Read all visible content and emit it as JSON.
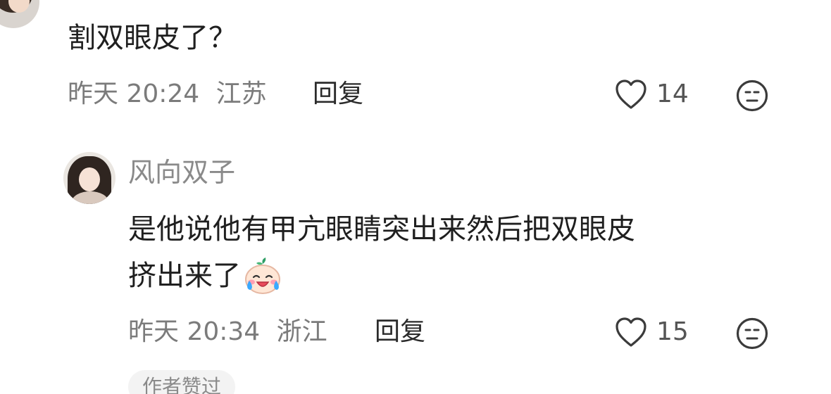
{
  "comment": {
    "text": "割双眼皮了？",
    "time": "昨天 20:24",
    "location": "江苏",
    "reply_label": "回复",
    "likes": "14",
    "like_icon": "heart-outline-icon",
    "dislike_icon": "neutral-face-icon"
  },
  "reply": {
    "author": "风向双子",
    "text_line1": "是他说他有甲亢眼睛突出来然后把双眼皮",
    "text_line2": "挤出来了",
    "emoji": "crying-laughing-sticker",
    "time": "昨天 20:34",
    "location": "浙江",
    "reply_label": "回复",
    "likes": "15",
    "like_icon": "heart-outline-icon",
    "dislike_icon": "neutral-face-icon",
    "author_liked_tag": "作者赞过"
  }
}
